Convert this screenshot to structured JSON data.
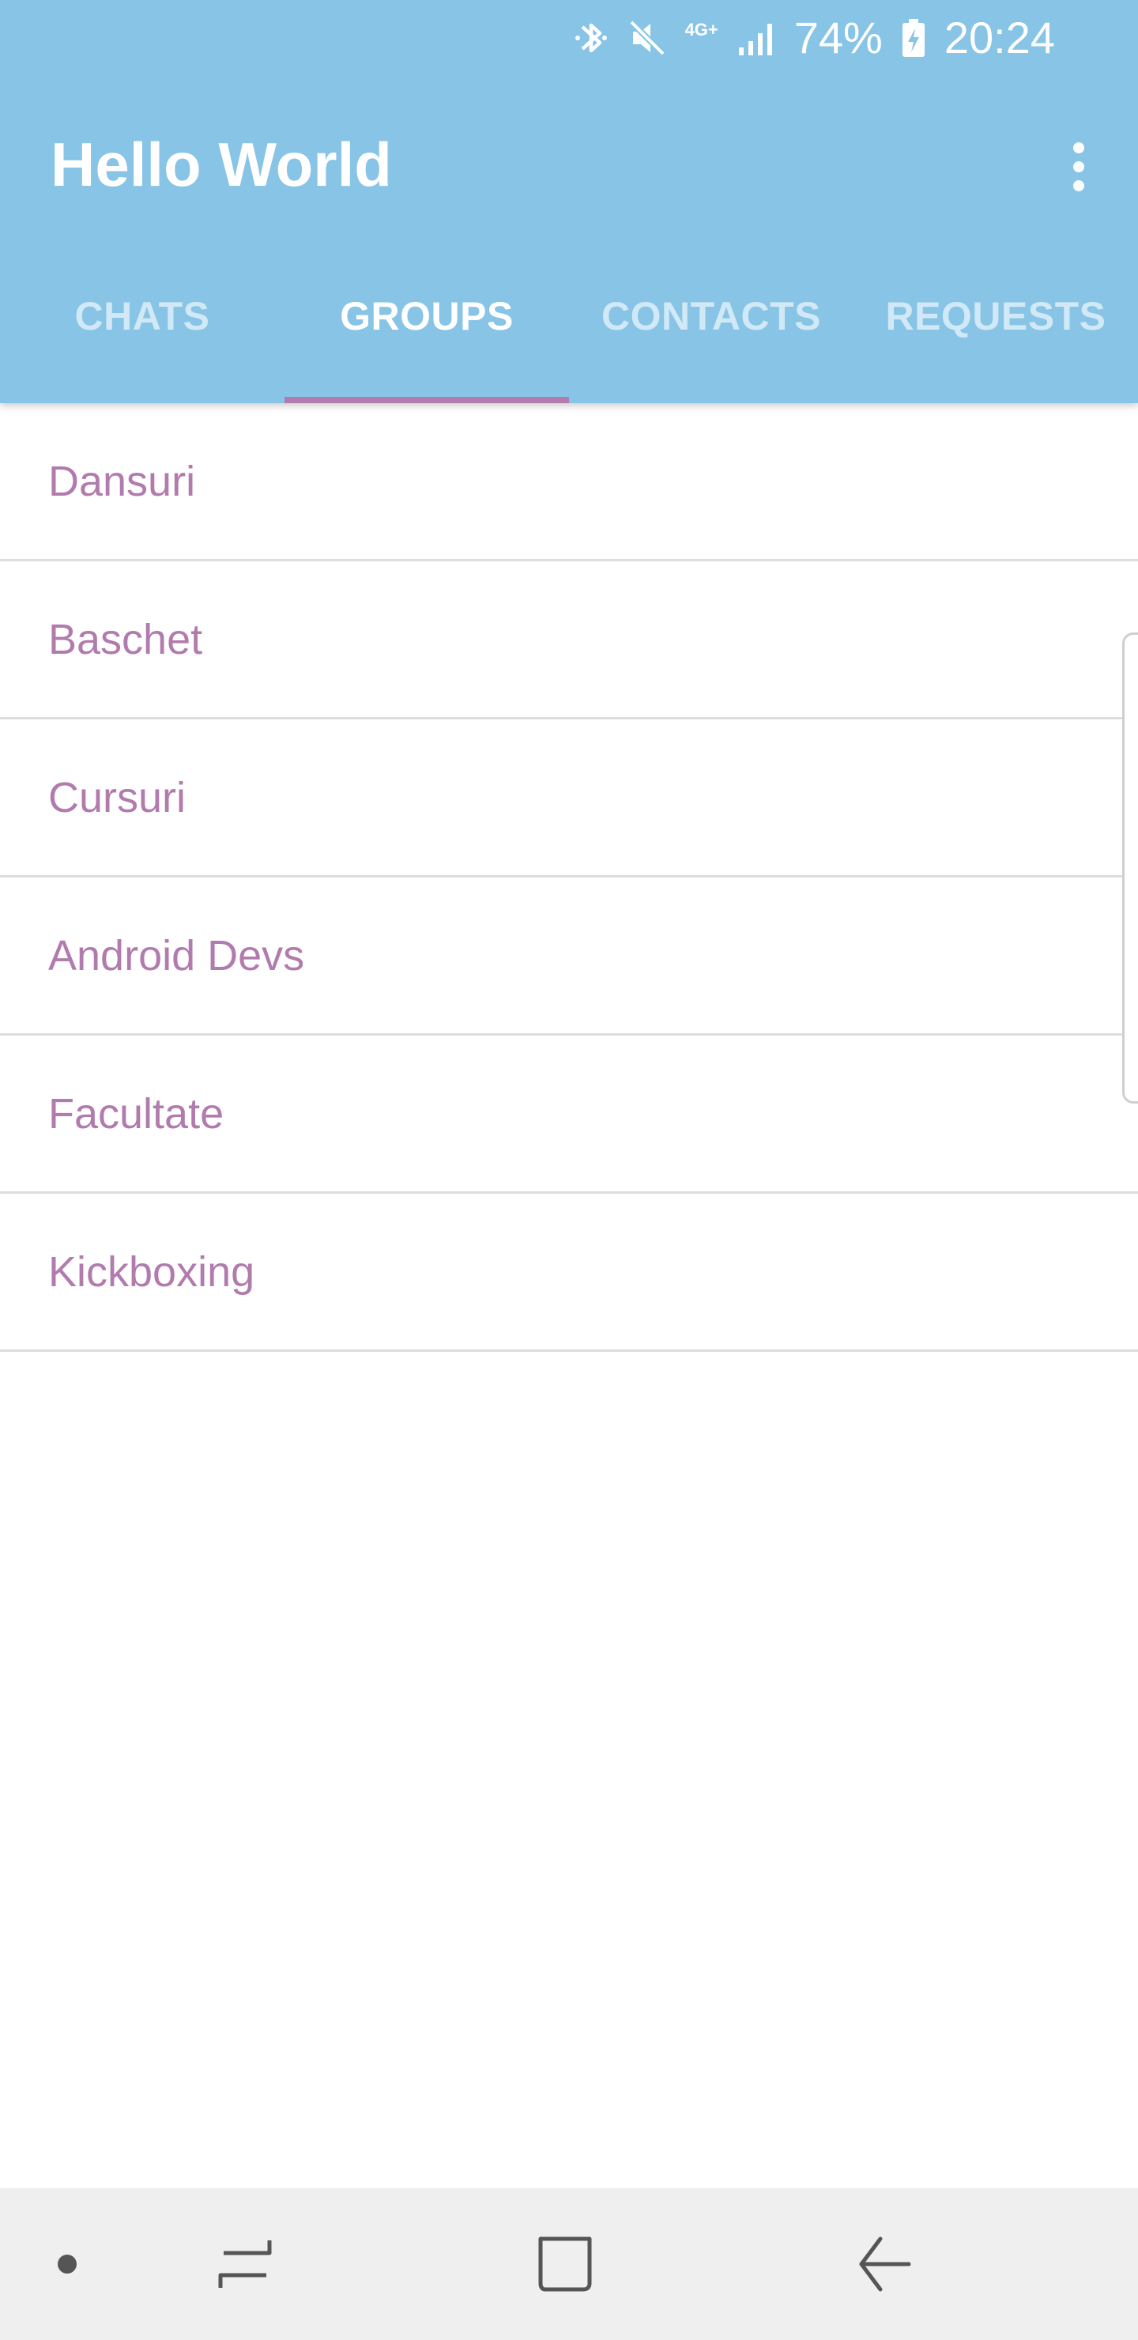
{
  "status_bar": {
    "icons": [
      "bluetooth-icon",
      "mute-icon",
      "network-4g-icon",
      "signal-icon",
      "battery-icon"
    ],
    "network_label": "4G+",
    "battery_percent": "74%",
    "time": "20:24"
  },
  "toolbar": {
    "title": "Hello World",
    "overflow_icon": "more-vert-icon"
  },
  "tabs": [
    {
      "label": "CHATS",
      "active": false
    },
    {
      "label": "GROUPS",
      "active": true
    },
    {
      "label": "CONTACTS",
      "active": false
    },
    {
      "label": "REQUESTS",
      "active": false
    }
  ],
  "groups": [
    {
      "name": "Dansuri"
    },
    {
      "name": "Baschet"
    },
    {
      "name": "Cursuri"
    },
    {
      "name": "Android Devs"
    },
    {
      "name": "Facultate"
    },
    {
      "name": "Kickboxing"
    }
  ],
  "nav_bar": {
    "buttons": [
      "dot-icon",
      "recents-icon",
      "home-icon",
      "back-icon"
    ]
  },
  "colors": {
    "app_bar": "#87C4E6",
    "accent": "#B27BAE",
    "divider": "#DDDDDD",
    "nav_bar": "#EFEFEF"
  }
}
